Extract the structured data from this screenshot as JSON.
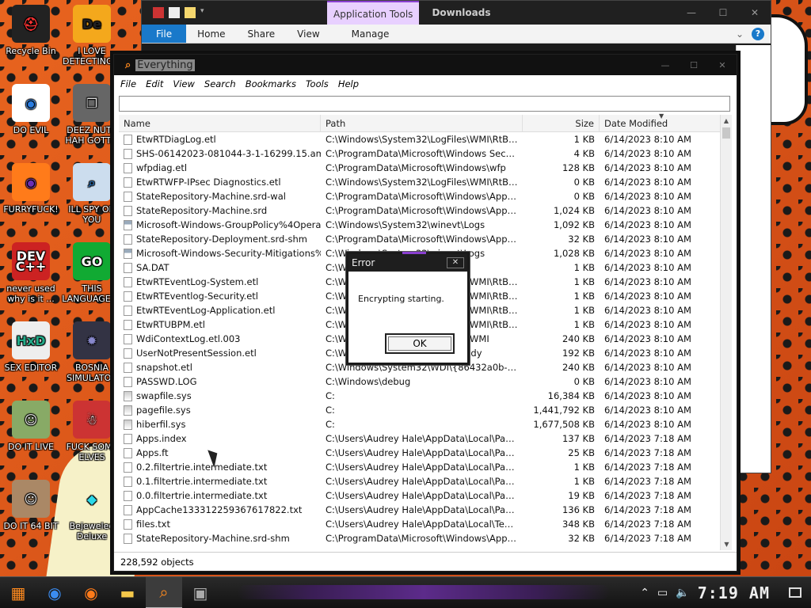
{
  "desktop": {
    "icons": [
      {
        "label": "Recycle Bin",
        "glyph": "⛑",
        "bg": "#222",
        "fg": "#f33"
      },
      {
        "label": "I LOVE DETECTING...",
        "glyph": "De",
        "bg": "#f4a81c",
        "fg": "#222"
      },
      {
        "label": "DO EVIL",
        "glyph": "◉",
        "bg": "#fff",
        "fg": "#2a7de1"
      },
      {
        "label": "DEEZ NUTS HAH GOTT...",
        "glyph": "❐",
        "bg": "#666",
        "fg": "#ddd"
      },
      {
        "label": "FURRYFUCK!",
        "glyph": "◉",
        "bg": "#ff7b1a",
        "fg": "#6b2fb3"
      },
      {
        "label": "ILL SPY ON YOU",
        "glyph": "⌕",
        "bg": "#cde",
        "fg": "#26a"
      },
      {
        "label": "never used why is it ...",
        "glyph": "DEV C++",
        "bg": "#c22",
        "fg": "#fff"
      },
      {
        "label": "THIS LANGUAGE ...",
        "glyph": "GO",
        "bg": "#1a3",
        "fg": "#fff"
      },
      {
        "label": "SEX EDITOR",
        "glyph": "HxD",
        "bg": "#eee",
        "fg": "#2a8"
      },
      {
        "label": "BOSNIA SIMULATOR",
        "glyph": "✹",
        "bg": "#334",
        "fg": "#88c"
      },
      {
        "label": "DO IT LIVE",
        "glyph": "☺",
        "bg": "#8a6",
        "fg": "#eee"
      },
      {
        "label": "FUCK SOME ELVES",
        "glyph": "☃",
        "bg": "#c33",
        "fg": "#fff"
      },
      {
        "label": "DO IT 64 BIT",
        "glyph": "☺",
        "bg": "#a86",
        "fg": "#eee"
      },
      {
        "label": "Bejeweled Deluxe",
        "glyph": "◆",
        "bg": "transparent",
        "fg": "#2bd8e8"
      }
    ]
  },
  "downloads_window": {
    "context_tab": "Application Tools",
    "title": "Downloads",
    "ribbon_tabs": [
      "File",
      "Home",
      "Share",
      "View",
      "Manage"
    ]
  },
  "everything": {
    "title": "Everything",
    "menu": [
      "File",
      "Edit",
      "View",
      "Search",
      "Bookmarks",
      "Tools",
      "Help"
    ],
    "search_value": "",
    "columns": {
      "name": "Name",
      "path": "Path",
      "size": "Size",
      "date": "Date Modified"
    },
    "rows": [
      {
        "name": "EtwRTDiagLog.etl",
        "path": "C:\\Windows\\System32\\LogFiles\\WMI\\RtBackup",
        "size": "1 KB",
        "date": "6/14/2023 8:10 AM",
        "icon": "file"
      },
      {
        "name": "SHS-06142023-081044-3-1-16299.15.amd64f...",
        "path": "C:\\ProgramData\\Microsoft\\Windows Security Heal...",
        "size": "4 KB",
        "date": "6/14/2023 8:10 AM",
        "icon": "file"
      },
      {
        "name": "wfpdiag.etl",
        "path": "C:\\ProgramData\\Microsoft\\Windows\\wfp",
        "size": "128 KB",
        "date": "6/14/2023 8:10 AM",
        "icon": "file"
      },
      {
        "name": "EtwRTWFP-IPsec Diagnostics.etl",
        "path": "C:\\Windows\\System32\\LogFiles\\WMI\\RtBackup",
        "size": "0 KB",
        "date": "6/14/2023 8:10 AM",
        "icon": "file"
      },
      {
        "name": "StateRepository-Machine.srd-wal",
        "path": "C:\\ProgramData\\Microsoft\\Windows\\AppRepository",
        "size": "0 KB",
        "date": "6/14/2023 8:10 AM",
        "icon": "file"
      },
      {
        "name": "StateRepository-Machine.srd",
        "path": "C:\\ProgramData\\Microsoft\\Windows\\AppRepository",
        "size": "1,024 KB",
        "date": "6/14/2023 8:10 AM",
        "icon": "file"
      },
      {
        "name": "Microsoft-Windows-GroupPolicy%4Operational....",
        "path": "C:\\Windows\\System32\\winevt\\Logs",
        "size": "1,092 KB",
        "date": "6/14/2023 8:10 AM",
        "icon": "evt"
      },
      {
        "name": "StateRepository-Deployment.srd-shm",
        "path": "C:\\ProgramData\\Microsoft\\Windows\\AppRepository",
        "size": "32 KB",
        "date": "6/14/2023 8:10 AM",
        "icon": "file"
      },
      {
        "name": "Microsoft-Windows-Security-Mitigations%4Kern...",
        "path": "C:\\Windows\\System32\\winevt\\Logs",
        "size": "1,028 KB",
        "date": "6/14/2023 8:10 AM",
        "icon": "evt"
      },
      {
        "name": "SA.DAT",
        "path": "C:\\Windows\\Tasks",
        "size": "1 KB",
        "date": "6/14/2023 8:10 AM",
        "icon": "file"
      },
      {
        "name": "EtwRTEventLog-System.etl",
        "path": "C:\\Windows\\System32\\LogFiles\\WMI\\RtBackup",
        "size": "1 KB",
        "date": "6/14/2023 8:10 AM",
        "icon": "file"
      },
      {
        "name": "EtwRTEventlog-Security.etl",
        "path": "C:\\Windows\\System32\\LogFiles\\WMI\\RtBackup",
        "size": "1 KB",
        "date": "6/14/2023 8:10 AM",
        "icon": "file"
      },
      {
        "name": "EtwRTEventLog-Application.etl",
        "path": "C:\\Windows\\System32\\LogFiles\\WMI\\RtBackup",
        "size": "1 KB",
        "date": "6/14/2023 8:10 AM",
        "icon": "file"
      },
      {
        "name": "EtwRTUBPM.etl",
        "path": "C:\\Windows\\System32\\LogFiles\\WMI\\RtBackup",
        "size": "1 KB",
        "date": "6/14/2023 8:10 AM",
        "icon": "file"
      },
      {
        "name": "WdiContextLog.etl.003",
        "path": "C:\\Windows\\System32\\LogFiles\\WMI",
        "size": "240 KB",
        "date": "6/14/2023 8:10 AM",
        "icon": "file"
      },
      {
        "name": "UserNotPresentSession.etl",
        "path": "C:\\Windows\\System32\\SleepStudy",
        "size": "192 KB",
        "date": "6/14/2023 8:10 AM",
        "icon": "file"
      },
      {
        "name": "snapshot.etl",
        "path": "C:\\Windows\\System32\\WDI\\{86432a0b-3c7d-4d...",
        "size": "240 KB",
        "date": "6/14/2023 8:10 AM",
        "icon": "file"
      },
      {
        "name": "PASSWD.LOG",
        "path": "C:\\Windows\\debug",
        "size": "0 KB",
        "date": "6/14/2023 8:10 AM",
        "icon": "file"
      },
      {
        "name": "swapfile.sys",
        "path": "C:",
        "size": "16,384 KB",
        "date": "6/14/2023 8:10 AM",
        "icon": "sys"
      },
      {
        "name": "pagefile.sys",
        "path": "C:",
        "size": "1,441,792 KB",
        "date": "6/14/2023 8:10 AM",
        "icon": "sys"
      },
      {
        "name": "hiberfil.sys",
        "path": "C:",
        "size": "1,677,508 KB",
        "date": "6/14/2023 8:10 AM",
        "icon": "sys"
      },
      {
        "name": "Apps.index",
        "path": "C:\\Users\\Audrey Hale\\AppData\\Local\\Packages...",
        "size": "137 KB",
        "date": "6/14/2023 7:18 AM",
        "icon": "file"
      },
      {
        "name": "Apps.ft",
        "path": "C:\\Users\\Audrey Hale\\AppData\\Local\\Packages...",
        "size": "25 KB",
        "date": "6/14/2023 7:18 AM",
        "icon": "file"
      },
      {
        "name": "0.2.filtertrie.intermediate.txt",
        "path": "C:\\Users\\Audrey Hale\\AppData\\Local\\Packages...",
        "size": "1 KB",
        "date": "6/14/2023 7:18 AM",
        "icon": "file"
      },
      {
        "name": "0.1.filtertrie.intermediate.txt",
        "path": "C:\\Users\\Audrey Hale\\AppData\\Local\\Packages...",
        "size": "1 KB",
        "date": "6/14/2023 7:18 AM",
        "icon": "file"
      },
      {
        "name": "0.0.filtertrie.intermediate.txt",
        "path": "C:\\Users\\Audrey Hale\\AppData\\Local\\Packages...",
        "size": "19 KB",
        "date": "6/14/2023 7:18 AM",
        "icon": "file"
      },
      {
        "name": "AppCache133312259367617822.txt",
        "path": "C:\\Users\\Audrey Hale\\AppData\\Local\\Packages...",
        "size": "136 KB",
        "date": "6/14/2023 7:18 AM",
        "icon": "file"
      },
      {
        "name": "files.txt",
        "path": "C:\\Users\\Audrey Hale\\AppData\\Local\\Temp\\a7b...",
        "size": "348 KB",
        "date": "6/14/2023 7:18 AM",
        "icon": "file"
      },
      {
        "name": "StateRepository-Machine.srd-shm",
        "path": "C:\\ProgramData\\Microsoft\\Windows\\AppRepository",
        "size": "32 KB",
        "date": "6/14/2023 7:18 AM",
        "icon": "file"
      }
    ],
    "status": "228,592 objects"
  },
  "dialog": {
    "title": "Error",
    "message": "Encrypting starting.",
    "ok_label": "OK",
    "close_glyph": "✕"
  },
  "taskbar": {
    "clock": "7:19 AM"
  }
}
